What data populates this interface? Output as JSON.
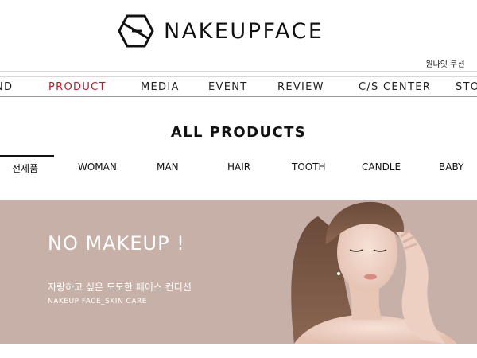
{
  "brand": {
    "name": "NAKEUPFACE"
  },
  "coupon_link": "원나잇 쿠션",
  "nav": {
    "items": [
      {
        "label": "ND",
        "active": false
      },
      {
        "label": "PRODUCT",
        "active": true
      },
      {
        "label": "MEDIA",
        "active": false
      },
      {
        "label": "EVENT",
        "active": false
      },
      {
        "label": "REVIEW",
        "active": false
      },
      {
        "label": "C/S CENTER",
        "active": false
      },
      {
        "label": "STO",
        "active": false
      }
    ]
  },
  "section": {
    "title": "ALL PRODUCTS"
  },
  "categories": [
    {
      "label": "전제품",
      "active": true
    },
    {
      "label": "WOMAN",
      "active": false
    },
    {
      "label": "MAN",
      "active": false
    },
    {
      "label": "HAIR",
      "active": false
    },
    {
      "label": "TOOTH",
      "active": false
    },
    {
      "label": "CANDLE",
      "active": false
    },
    {
      "label": "BABY",
      "active": false
    }
  ],
  "banner": {
    "title": "NO MAKEUP !",
    "subtitle": "자랑하고 싶은 도도한 페이스 컨디션",
    "tagline": "NAKEUP FACE_SKIN CARE",
    "background_color": "#c6b0a7"
  },
  "colors": {
    "accent": "#b51d2a",
    "text": "#111111"
  }
}
